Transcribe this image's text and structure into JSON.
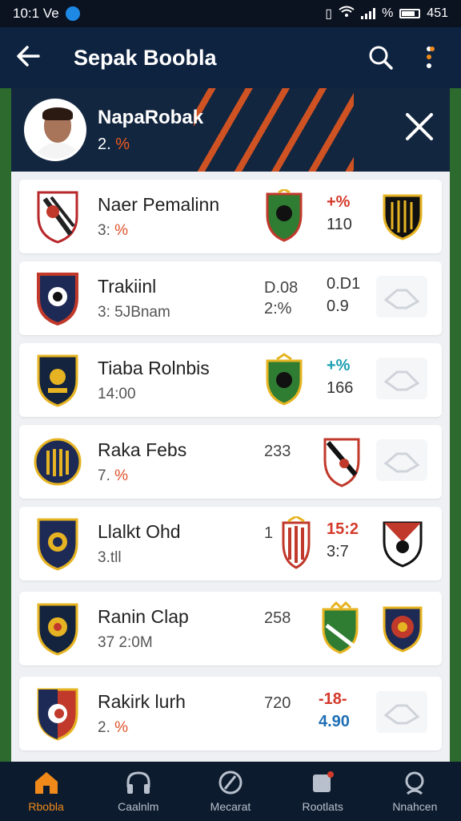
{
  "status_bar": {
    "time": "10:1 Ve",
    "right_text": "451",
    "signal_text": "%"
  },
  "app_bar": {
    "title": "Sepak Boobla"
  },
  "profile": {
    "name": "NapaRobak",
    "sub_num": "2.",
    "sub_accent": "%"
  },
  "teams": [
    {
      "name": "Naer Pemalinn",
      "sub": "3:",
      "sub_accent": "%",
      "score_a_top": "+%",
      "score_a_bottom": "110",
      "has_mid_crest": true,
      "right": "crest"
    },
    {
      "name": "Trakiinl",
      "sub": "3: 5JBnam",
      "sub_accent": "",
      "score1_top": "D.08",
      "score1_bottom": "2:%",
      "score_a_top": "0.D1",
      "score_a_bottom": "0.9",
      "right": "share"
    },
    {
      "name": "Tiaba Rolnbis",
      "sub": "14:00",
      "sub_accent": "",
      "score_a_top": "+%",
      "score_a_bottom": "166",
      "has_mid_crest": true,
      "right": "share"
    },
    {
      "name": "Raka Febs",
      "sub": "7.",
      "sub_accent": "%",
      "score1_top": "233",
      "score1_bottom": "",
      "right": "crest_mid"
    },
    {
      "name": "Llalkt Ohd",
      "sub": "3.tll",
      "sub_accent": "",
      "score1_top": "1",
      "score_a_top": "15:2",
      "score_a_bottom": "3:7",
      "right": "crest"
    },
    {
      "name": "Ranin Clap",
      "sub": "37 2:0M",
      "sub_accent": "",
      "score1_top": "258",
      "right": "crest"
    },
    {
      "name": "Rakirk lurh",
      "sub": "2.",
      "sub_accent": "%",
      "score1_top": "720",
      "score_a_top": "-18-",
      "score_a_bottom": "4.90",
      "right": "share"
    }
  ],
  "bottom_nav": [
    {
      "label": "Rbobla",
      "icon": "home-icon",
      "active": true
    },
    {
      "label": "Caalnlm",
      "icon": "headphones-icon",
      "active": false
    },
    {
      "label": "Mecarat",
      "icon": "compass-icon",
      "active": false
    },
    {
      "label": "Rootlats",
      "icon": "notifications-icon",
      "active": false
    },
    {
      "label": "Nnahcen",
      "icon": "profile-icon",
      "active": false
    }
  ],
  "colors": {
    "accent": "#ef8a1a",
    "navy": "#0e2340",
    "stripe": "#f05a1e"
  }
}
